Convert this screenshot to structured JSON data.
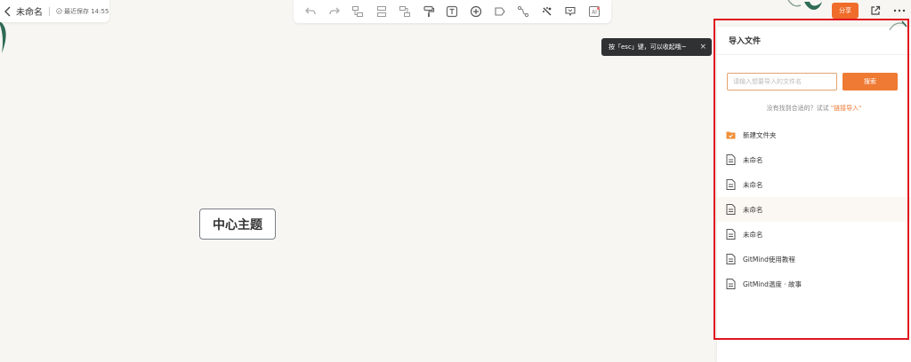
{
  "header": {
    "doc_title": "未命名",
    "save_status": "最近保存 14:55"
  },
  "toolbar": {
    "tools": [
      {
        "name": "undo-icon"
      },
      {
        "name": "redo-icon"
      },
      {
        "name": "insert-child-node-icon"
      },
      {
        "name": "insert-sibling-node-icon"
      },
      {
        "name": "insert-parent-node-icon"
      },
      {
        "name": "format-painter-icon"
      },
      {
        "name": "text-style-icon"
      },
      {
        "name": "add-circle-icon"
      },
      {
        "name": "tag-icon"
      },
      {
        "name": "relation-line-icon"
      },
      {
        "name": "summary-icon"
      },
      {
        "name": "outline-frame-icon"
      },
      {
        "name": "ai-icon"
      }
    ]
  },
  "actions": {
    "share_label": "分享"
  },
  "tip": {
    "text": "按「esc」键，可以收起哦~",
    "close": "×"
  },
  "canvas": {
    "center_node": "中心主题"
  },
  "import_panel": {
    "title": "导入文件",
    "search_placeholder": "请输入想要导入的文件名",
    "search_button": "搜索",
    "no_result_text": "没有找到合适的？试试",
    "no_result_link": "\"链接导入\"",
    "files": [
      {
        "type": "folder",
        "name": "新建文件夹"
      },
      {
        "type": "file",
        "name": "未命名"
      },
      {
        "type": "file",
        "name": "未命名"
      },
      {
        "type": "file",
        "name": "未命名"
      },
      {
        "type": "file",
        "name": "未命名"
      },
      {
        "type": "file",
        "name": "GitMind使用教程"
      },
      {
        "type": "file",
        "name": "GitMind温度 · 故事"
      }
    ]
  },
  "colors": {
    "accent": "#ef7a33",
    "highlight": "#e0141e",
    "canvas_bg": "#f7f6f2"
  }
}
